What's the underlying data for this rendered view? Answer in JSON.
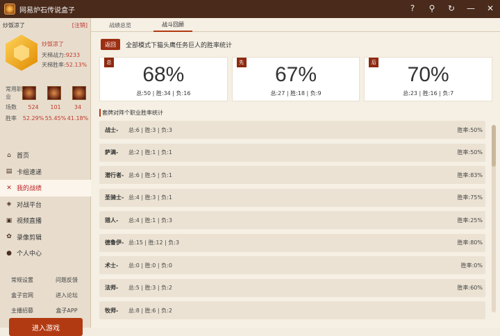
{
  "window": {
    "title": "网易炉石传说盒子"
  },
  "user": {
    "name": "炒饭凉了",
    "logout": "[注销]",
    "display_name": "炒饭凉了",
    "power_label": "天梯战力:",
    "power_value": "9233",
    "winrate_label": "天梯胜率:",
    "winrate_value": "52.13%"
  },
  "class_stats": {
    "row_labels": {
      "common": "常用职业",
      "games": "场数",
      "winrate": "胜率"
    },
    "games": [
      "524",
      "101",
      "34"
    ],
    "winrates": [
      "52.29%",
      "55.45%",
      "41.18%"
    ]
  },
  "nav": [
    {
      "label": "首页",
      "icon": "home-icon",
      "active": false
    },
    {
      "label": "卡组速递",
      "icon": "cards-icon",
      "active": false
    },
    {
      "label": "我的战绩",
      "icon": "swords-icon",
      "active": true
    },
    {
      "label": "对战平台",
      "icon": "shield-icon",
      "active": false
    },
    {
      "label": "视频直播",
      "icon": "video-icon",
      "active": false
    },
    {
      "label": "录像剪辑",
      "icon": "film-icon",
      "active": false
    },
    {
      "label": "个人中心",
      "icon": "person-icon",
      "active": false
    }
  ],
  "links": [
    [
      "常规设置",
      "问题反馈"
    ],
    [
      "盒子官网",
      "进入论坛"
    ],
    [
      "主播招募",
      "盒子APP"
    ]
  ],
  "enter_game": "进入游戏",
  "tabs": [
    "战绩总览",
    "战斗回顾"
  ],
  "back": "返回",
  "subtitle": "全部模式下猫头鹰任务巨人的胜率统计",
  "summary": [
    {
      "tag": "总",
      "pct": "68%",
      "counts": "总:50 | 胜:34 | 负:16"
    },
    {
      "tag": "先",
      "pct": "67%",
      "counts": "总:27 | 胜:18 | 负:9"
    },
    {
      "tag": "后",
      "pct": "70%",
      "counts": "总:23 | 胜:16 | 负:7"
    }
  ],
  "section_title": "套牌对阵个职业胜率统计",
  "rows": [
    {
      "cls": "战士-",
      "stats": "总:6 | 胜:3 | 负:3",
      "rate": "胜率:50%"
    },
    {
      "cls": "萨满-",
      "stats": "总:2 | 胜:1 | 负:1",
      "rate": "胜率:50%"
    },
    {
      "cls": "潜行者-",
      "stats": "总:6 | 胜:5 | 负:1",
      "rate": "胜率:83%"
    },
    {
      "cls": "圣骑士-",
      "stats": "总:4 | 胜:3 | 负:1",
      "rate": "胜率:75%"
    },
    {
      "cls": "猎人-",
      "stats": "总:4 | 胜:1 | 负:3",
      "rate": "胜率:25%"
    },
    {
      "cls": "德鲁伊-",
      "stats": "总:15 | 胜:12 | 负:3",
      "rate": "胜率:80%"
    },
    {
      "cls": "术士-",
      "stats": "总:0 | 胜:0 | 负:0",
      "rate": "胜率:0%"
    },
    {
      "cls": "法师-",
      "stats": "总:5 | 胜:3 | 负:2",
      "rate": "胜率:60%"
    },
    {
      "cls": "牧师-",
      "stats": "总:8 | 胜:6 | 负:2",
      "rate": ""
    }
  ]
}
